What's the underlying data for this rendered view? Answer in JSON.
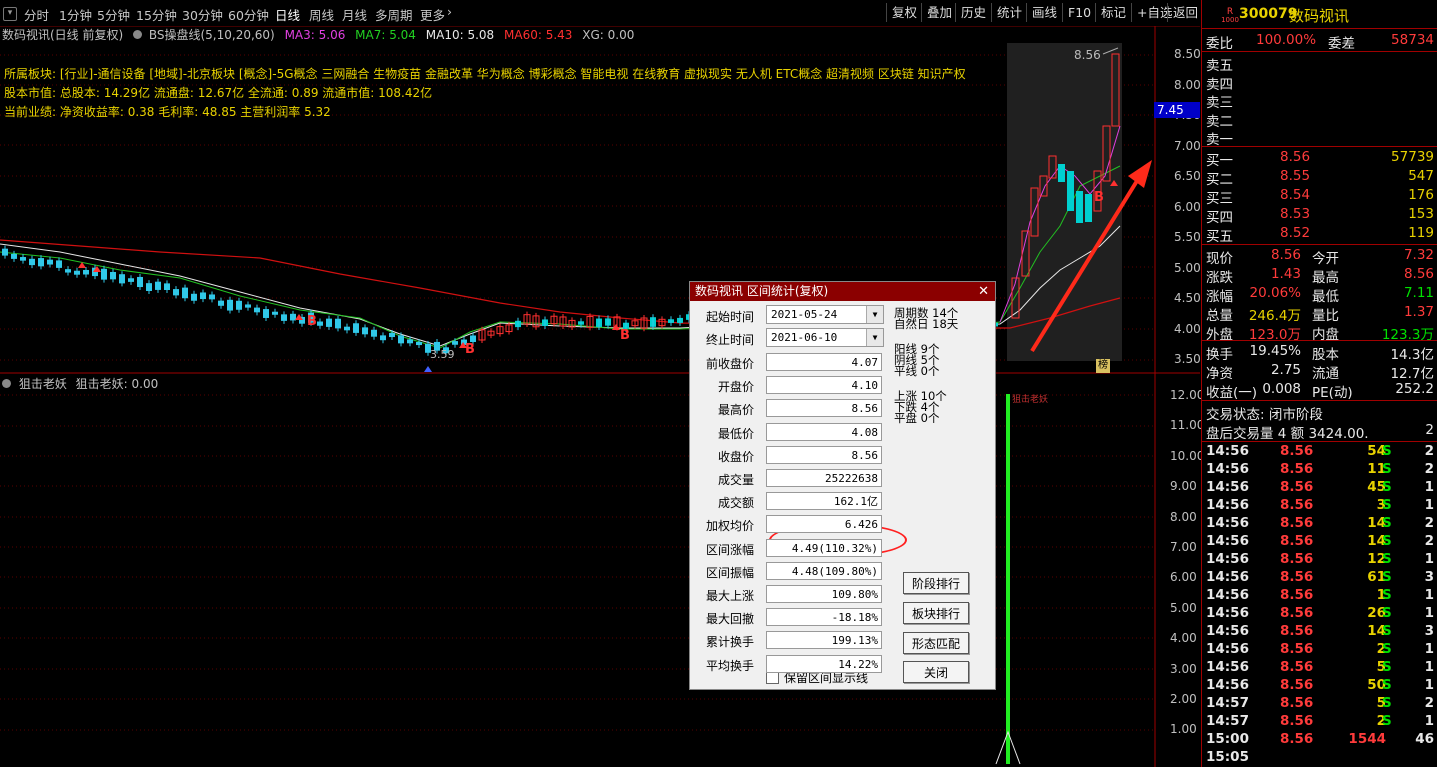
{
  "toolbar": {
    "periods": [
      "分时",
      "1分钟",
      "5分钟",
      "15分钟",
      "30分钟",
      "60分钟",
      "日线",
      "周线",
      "月线",
      "多周期",
      "更多"
    ],
    "active_period": "日线",
    "buttons": [
      "复权",
      "叠加",
      "历史",
      "统计",
      "画线",
      "F10",
      "标记",
      "+自选",
      "返回"
    ]
  },
  "chart": {
    "title": "数码视讯(日线 前复权)",
    "indicator_name": "BS操盘线(5,10,20,60)",
    "ma3": "MA3: 5.06",
    "ma7": "MA7: 5.04",
    "ma10": "MA10: 5.08",
    "ma60": "MA60: 5.43",
    "xg": "XG: 0.00",
    "sector_line": "所属板块: [行业]-通信设备 [地域]-北京板块 [概念]-5G概念 三网融合 生物疫苗 金融改革 华为概念 博彩概念 智能电视 在线教育 虚拟现实 无人机 ETC概念 超清视频 区块链 知识产权",
    "capital_line": "股本市值: 总股本: 14.29亿 流通盘: 12.67亿 全流通: 0.89 流通市值: 108.42亿",
    "perf_line": "当前业绩: 净资收益率: 0.38 毛利率: 48.85 主营利润率 5.32",
    "price_axis": [
      "8.50",
      "8.00",
      "7.50",
      "7.00",
      "6.50",
      "6.00",
      "5.50",
      "5.00",
      "4.50",
      "4.00",
      "3.50"
    ],
    "current_price_tag": "7.45",
    "high_mark": "8.56",
    "low_mark": "3.59",
    "bang_label": "榜",
    "b_marker": "B",
    "indicator_panel_label": "狙击老妖",
    "indicator_panel_value": "狙击老妖: 0.00",
    "indicator_bar_label": "狙击老妖",
    "indicator_axis": [
      "12.00",
      "11.00",
      "10.00",
      "9.00",
      "8.00",
      "7.00",
      "6.00",
      "5.00",
      "4.00",
      "3.00",
      "2.00",
      "1.00"
    ]
  },
  "dialog": {
    "title": "数码视讯 区间统计(复权)",
    "start_label": "起始时间",
    "start_value": "2021-05-24",
    "end_label": "终止时间",
    "end_value": "2021-06-10",
    "fields": [
      {
        "label": "前收盘价",
        "value": "4.07"
      },
      {
        "label": "开盘价",
        "value": "4.10"
      },
      {
        "label": "最高价",
        "value": "8.56"
      },
      {
        "label": "最低价",
        "value": "4.08"
      },
      {
        "label": "收盘价",
        "value": "8.56"
      },
      {
        "label": "成交量",
        "value": "25222638"
      },
      {
        "label": "成交额",
        "value": "162.1亿"
      },
      {
        "label": "加权均价",
        "value": "6.426"
      },
      {
        "label": "区间涨幅",
        "value": "4.49(110.32%)"
      },
      {
        "label": "区间振幅",
        "value": "4.48(109.80%)"
      },
      {
        "label": "最大上涨",
        "value": "109.80%"
      },
      {
        "label": "最大回撤",
        "value": "-18.18%"
      },
      {
        "label": "累计换手",
        "value": "199.13%"
      },
      {
        "label": "平均换手",
        "value": "14.22%"
      }
    ],
    "stats": [
      "周期数 14个",
      "自然日 18天",
      "阳线 9个",
      "阴线 5个",
      "平线 0个",
      "上涨 10个",
      "下跌 4个",
      "平盘 0个"
    ],
    "buttons": [
      "阶段排行",
      "板块排行",
      "形态匹配",
      "关闭"
    ],
    "checkbox_label": "保留区间显示线"
  },
  "quote": {
    "badge_top": "R",
    "badge_bottom": "1000",
    "code": "300079",
    "name": "数码视讯",
    "weibi_label": "委比",
    "weibi_value": "100.00%",
    "weicha_label": "委差",
    "weicha_value": "58734",
    "sells": [
      "卖五",
      "卖四",
      "卖三",
      "卖二",
      "卖一"
    ],
    "buys": [
      {
        "label": "买一",
        "price": "8.56",
        "vol": "57739"
      },
      {
        "label": "买二",
        "price": "8.55",
        "vol": "547"
      },
      {
        "label": "买三",
        "price": "8.54",
        "vol": "176"
      },
      {
        "label": "买四",
        "price": "8.53",
        "vol": "153"
      },
      {
        "label": "买五",
        "price": "8.52",
        "vol": "119"
      }
    ],
    "stats": [
      {
        "l1": "现价",
        "v1": "8.56",
        "l2": "今开",
        "v2": "7.32"
      },
      {
        "l1": "涨跌",
        "v1": "1.43",
        "l2": "最高",
        "v2": "8.56"
      },
      {
        "l1": "涨幅",
        "v1": "20.06%",
        "l2": "最低",
        "v2": "7.11"
      },
      {
        "l1": "总量",
        "v1": "246.4万",
        "l2": "量比",
        "v2": "1.37"
      },
      {
        "l1": "外盘",
        "v1": "123.0万",
        "l2": "内盘",
        "v2": "123.3万"
      }
    ],
    "stats2": [
      {
        "l1": "换手",
        "v1": "19.45%",
        "l2": "股本",
        "v2": "14.3亿"
      },
      {
        "l1": "净资",
        "v1": "2.75",
        "l2": "流通",
        "v2": "12.7亿"
      },
      {
        "l1": "收益(一)",
        "v1": "0.008",
        "l2": "PE(动)",
        "v2": "252.2"
      }
    ],
    "trade_state": "交易状态: 闭市阶段",
    "after_hours": "盘后交易量 4 额 3424.00.",
    "after_hours_count": "2",
    "ticks": [
      {
        "t": "14:56",
        "p": "8.56",
        "v": "54",
        "s": "S",
        "n": "2"
      },
      {
        "t": "14:56",
        "p": "8.56",
        "v": "11",
        "s": "S",
        "n": "2"
      },
      {
        "t": "14:56",
        "p": "8.56",
        "v": "45",
        "s": "S",
        "n": "1"
      },
      {
        "t": "14:56",
        "p": "8.56",
        "v": "3",
        "s": "S",
        "n": "1"
      },
      {
        "t": "14:56",
        "p": "8.56",
        "v": "14",
        "s": "S",
        "n": "2"
      },
      {
        "t": "14:56",
        "p": "8.56",
        "v": "14",
        "s": "S",
        "n": "2"
      },
      {
        "t": "14:56",
        "p": "8.56",
        "v": "12",
        "s": "S",
        "n": "1"
      },
      {
        "t": "14:56",
        "p": "8.56",
        "v": "61",
        "s": "S",
        "n": "3"
      },
      {
        "t": "14:56",
        "p": "8.56",
        "v": "1",
        "s": "S",
        "n": "1"
      },
      {
        "t": "14:56",
        "p": "8.56",
        "v": "26",
        "s": "S",
        "n": "1"
      },
      {
        "t": "14:56",
        "p": "8.56",
        "v": "14",
        "s": "S",
        "n": "3"
      },
      {
        "t": "14:56",
        "p": "8.56",
        "v": "2",
        "s": "S",
        "n": "1"
      },
      {
        "t": "14:56",
        "p": "8.56",
        "v": "5",
        "s": "S",
        "n": "1"
      },
      {
        "t": "14:56",
        "p": "8.56",
        "v": "50",
        "s": "S",
        "n": "1"
      },
      {
        "t": "14:57",
        "p": "8.56",
        "v": "5",
        "s": "S",
        "n": "2"
      },
      {
        "t": "14:57",
        "p": "8.56",
        "v": "2",
        "s": "S",
        "n": "1"
      },
      {
        "t": "15:00",
        "p": "8.56",
        "v": "1544",
        "s": "",
        "n": "46"
      },
      {
        "t": "15:05",
        "p": "",
        "v": "",
        "s": "",
        "n": ""
      }
    ]
  }
}
